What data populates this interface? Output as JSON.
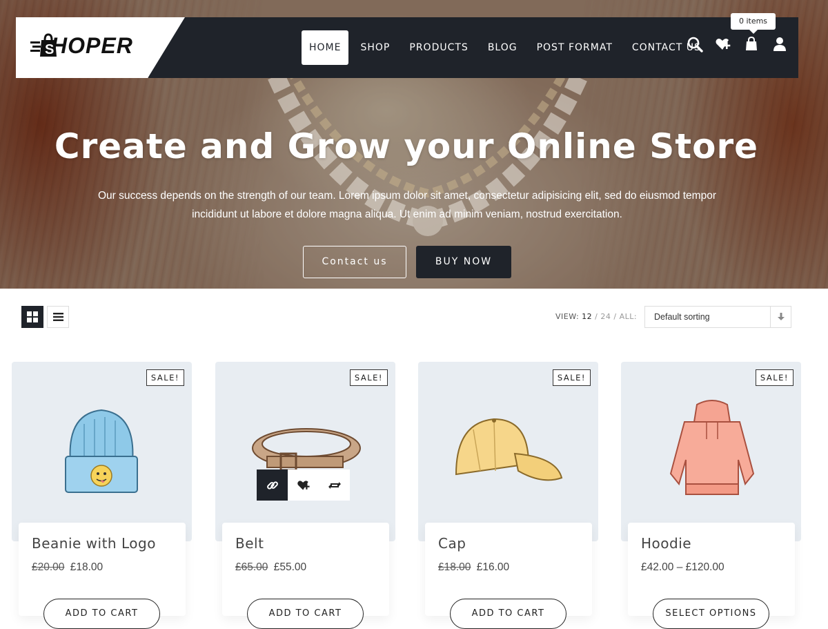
{
  "header": {
    "logo_text": "HOPER",
    "cart_tooltip": "0 items",
    "nav": [
      {
        "label": "HOME"
      },
      {
        "label": "SHOP"
      },
      {
        "label": "PRODUCTS"
      },
      {
        "label": "BLOG"
      },
      {
        "label": "POST FORMAT"
      },
      {
        "label": "CONTACT US"
      }
    ],
    "icons": [
      "search-icon",
      "wishlist-icon",
      "cart-icon",
      "account-icon"
    ]
  },
  "hero": {
    "title": "Create and Grow your Online Store",
    "subtitle_line1": "Our success depends on the strength of our team. Lorem ipsum dolor sit amet, consectetur adipisicing elit, sed do eiusmod tempor",
    "subtitle_line2": "incididunt ut labore et dolore magna aliqua. Ut enim ad minim veniam, nostrud exercitation.",
    "btn_contact": "Contact us",
    "btn_buy": "BUY NOW"
  },
  "toolbar": {
    "view_label": "VIEW:",
    "view_12": "12",
    "view_24": "24",
    "view_all": "ALL:",
    "slash": "/",
    "sort_selected": "Default sorting"
  },
  "products": [
    {
      "name": "Beanie with Logo",
      "old_price": "£20.00",
      "price": "£18.00",
      "badge": "SALE!",
      "button": "ADD TO CART"
    },
    {
      "name": "Belt",
      "old_price": "£65.00",
      "price": "£55.00",
      "badge": "SALE!",
      "button": "ADD TO CART"
    },
    {
      "name": "Cap",
      "old_price": "£18.00",
      "price": "£16.00",
      "badge": "SALE!",
      "button": "ADD TO CART"
    },
    {
      "name": "Hoodie",
      "old_price": "",
      "price": "£42.00 – £120.00",
      "badge": "SALE!",
      "button": "SELECT OPTIONS"
    }
  ],
  "colors": {
    "dark": "#1f232a",
    "card_bg": "#e8edf2",
    "white": "#ffffff"
  }
}
